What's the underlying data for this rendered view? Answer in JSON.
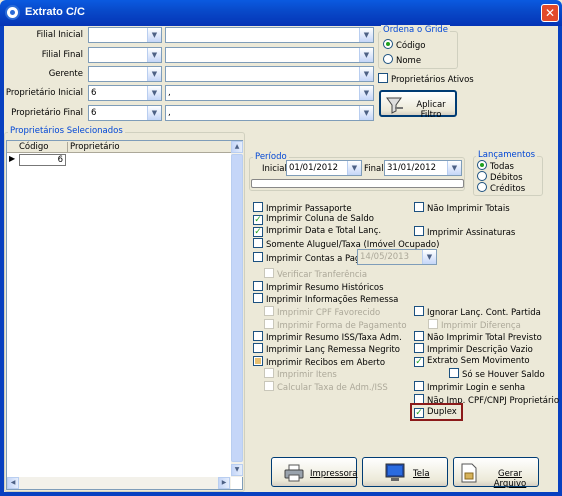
{
  "window": {
    "title": "Extrato C/C",
    "close": "✕"
  },
  "filters": {
    "filial_inicial": {
      "label": "Filial Inicial",
      "code": "",
      "name": ""
    },
    "filial_final": {
      "label": "Filial Final",
      "code": "",
      "name": ""
    },
    "gerente": {
      "label": "Gerente",
      "code": "",
      "name": ""
    },
    "proprietario_inicial": {
      "label": "Proprietário Inicial",
      "code": "6",
      "name": ","
    },
    "proprietario_final": {
      "label": "Proprietário Final",
      "code": "6",
      "name": ","
    }
  },
  "ordena": {
    "title": "Ordena o Gride",
    "options": [
      {
        "label": "Código",
        "selected": true
      },
      {
        "label": "Nome",
        "selected": false
      }
    ]
  },
  "proprietarios_ativos": {
    "label": "Proprietários Ativos",
    "checked": false
  },
  "aplicar_filtro": {
    "label": "Aplicar Filtro"
  },
  "grid": {
    "title": "Proprietários Selecionados",
    "columns": [
      "Código",
      "Proprietário"
    ],
    "rows": [
      {
        "codigo": "6",
        "proprietario": ""
      }
    ]
  },
  "periodo": {
    "title": "Período",
    "inicial_label": "Inicial",
    "inicial": "01/01/2012",
    "final_label": "Final",
    "final": "31/01/2012"
  },
  "lancamentos": {
    "title": "Lançamentos",
    "options": [
      {
        "label": "Todas",
        "selected": true
      },
      {
        "label": "Débitos",
        "selected": false
      },
      {
        "label": "Créditos",
        "selected": false
      }
    ]
  },
  "options_left": [
    {
      "label": "Imprimir Passaporte",
      "checked": false,
      "enabled": true
    },
    {
      "label": "Imprimir Coluna de Saldo",
      "checked": true,
      "enabled": true
    },
    {
      "label": "Imprimir Data e Total Lanç.",
      "checked": true,
      "enabled": true
    },
    {
      "label": "Somente Aluguel/Taxa (Imóvel Ocupado)",
      "checked": false,
      "enabled": true
    },
    {
      "label": "Imprimir Contas a Pagar",
      "checked": false,
      "enabled": true
    },
    {
      "label": "Verificar Tranferência",
      "checked": false,
      "enabled": false
    },
    {
      "label": "Imprimir Resumo Históricos",
      "checked": false,
      "enabled": true
    },
    {
      "label": "Imprimir Informações Remessa",
      "checked": false,
      "enabled": true
    },
    {
      "label": "Imprimir CPF Favorecido",
      "checked": false,
      "enabled": false
    },
    {
      "label": "Imprimir Forma de Pagamento",
      "checked": false,
      "enabled": false
    },
    {
      "label": "Imprimir Resumo ISS/Taxa Adm.",
      "checked": false,
      "enabled": true
    },
    {
      "label": "Imprimir Lanç Remessa Negrito",
      "checked": false,
      "enabled": true
    },
    {
      "label": "Imprimir Recibos em Aberto",
      "checked": false,
      "enabled": true,
      "indeterminate": true
    },
    {
      "label": "Imprimir Itens",
      "checked": false,
      "enabled": false
    },
    {
      "label": "Calcular Taxa de Adm./ISS",
      "checked": false,
      "enabled": false
    }
  ],
  "contas_pagar_date": "14/05/2013",
  "options_right": [
    {
      "label": "Não Imprimir Totais",
      "checked": false,
      "enabled": true
    },
    {
      "label": "Imprimir Assinaturas",
      "checked": false,
      "enabled": true
    },
    {
      "label": "Ignorar Lanç. Cont. Partida",
      "checked": false,
      "enabled": true
    },
    {
      "label": "Imprimir Diferença",
      "checked": false,
      "enabled": false
    },
    {
      "label": "Não Imprimir Total Previsto",
      "checked": false,
      "enabled": true
    },
    {
      "label": "Imprimir Descrição Vazio",
      "checked": false,
      "enabled": true
    },
    {
      "label": "Extrato Sem Movimento",
      "checked": true,
      "enabled": true
    },
    {
      "label": "Só se Houver Saldo",
      "checked": false,
      "enabled": true
    },
    {
      "label": "Imprimir Login e senha",
      "checked": false,
      "enabled": true
    },
    {
      "label": "Não Imp. CPF/CNPJ Proprietário",
      "checked": false,
      "enabled": true
    },
    {
      "label": "Duplex",
      "checked": true,
      "enabled": true,
      "highlighted": true
    }
  ],
  "buttons": {
    "impressora": "Impressora",
    "tela": "Tela",
    "gerar_arquivo": "Gerar Arquivo"
  },
  "colors": {
    "titlebar": "#0a5ae0",
    "highlight": "#8b1a1a",
    "groupTitle": "#0046d5"
  },
  "icons": [
    "window-icon",
    "printer-icon",
    "monitor-icon",
    "save-file-icon",
    "filter-icon"
  ]
}
